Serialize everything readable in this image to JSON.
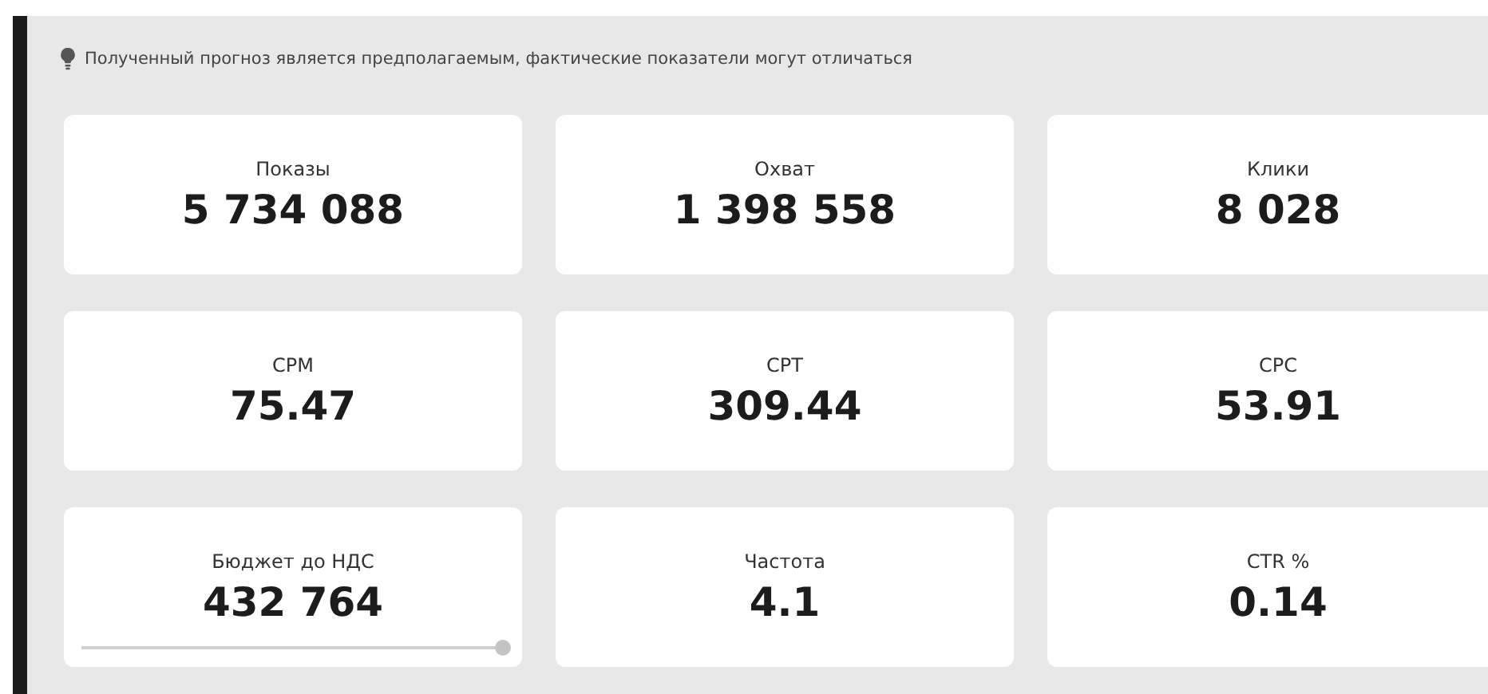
{
  "notice": {
    "text": "Полученный прогноз является предполагаемым, фактические показатели могут отличаться"
  },
  "metrics": [
    {
      "kind": "plain",
      "label": "Показы",
      "value": "5 734 088"
    },
    {
      "kind": "plain",
      "label": "Охват",
      "value": "1 398 558"
    },
    {
      "kind": "plain",
      "label": "Клики",
      "value": "8 028"
    },
    {
      "kind": "plain",
      "label": "CPM",
      "value": "75.47"
    },
    {
      "kind": "plain",
      "label": "CPT",
      "value": "309.44"
    },
    {
      "kind": "plain",
      "label": "CPC",
      "value": "53.91"
    },
    {
      "kind": "slider",
      "label": "Бюджет до НДС",
      "value": "432 764",
      "level": 1
    },
    {
      "kind": "plain",
      "label": "Частота",
      "value": "4.1"
    },
    {
      "kind": "plain",
      "label": "CTR %",
      "value": "0.14"
    }
  ]
}
